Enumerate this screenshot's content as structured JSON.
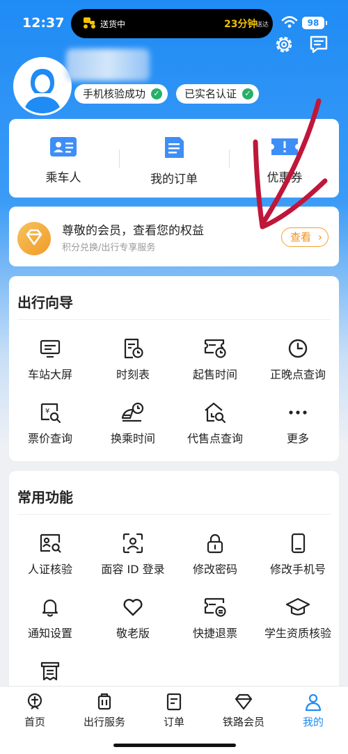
{
  "status_bar": {
    "time": "12:37",
    "island_label": "送货中",
    "island_time": "23分钟",
    "island_suffix": "送达",
    "battery": "98"
  },
  "profile": {
    "badges": [
      "手机核验成功",
      "已实名认证"
    ]
  },
  "quick_actions": [
    {
      "label": "乘车人",
      "icon": "passenger-card-icon"
    },
    {
      "label": "我的订单",
      "icon": "order-doc-icon"
    },
    {
      "label": "优惠券",
      "icon": "coupon-icon"
    }
  ],
  "member": {
    "title": "尊敬的会员，查看您的权益",
    "subtitle": "积分兑换/出行专享服务",
    "button": "查看"
  },
  "travel_guide": {
    "title": "出行向导",
    "items": [
      {
        "label": "车站大屏",
        "icon": "station-screen-icon"
      },
      {
        "label": "时刻表",
        "icon": "timetable-icon"
      },
      {
        "label": "起售时间",
        "icon": "ticket-clock-icon"
      },
      {
        "label": "正晚点查询",
        "icon": "clock-icon"
      },
      {
        "label": "票价查询",
        "icon": "price-search-icon"
      },
      {
        "label": "换乘时间",
        "icon": "transfer-time-icon"
      },
      {
        "label": "代售点查询",
        "icon": "agency-search-icon"
      },
      {
        "label": "更多",
        "icon": "more-dots-icon"
      }
    ]
  },
  "common_functions": {
    "title": "常用功能",
    "items": [
      {
        "label": "人证核验",
        "icon": "id-verify-icon"
      },
      {
        "label": "面容 ID 登录",
        "icon": "face-id-icon"
      },
      {
        "label": "修改密码",
        "icon": "lock-icon"
      },
      {
        "label": "修改手机号",
        "icon": "phone-icon"
      },
      {
        "label": "通知设置",
        "icon": "bell-icon"
      },
      {
        "label": "敬老版",
        "icon": "heart-icon"
      },
      {
        "label": "快捷退票",
        "icon": "refund-ticket-icon"
      },
      {
        "label": "学生资质核验",
        "icon": "graduation-cap-icon"
      },
      {
        "label": "",
        "icon": "receipt-icon"
      }
    ]
  },
  "tabbar": [
    {
      "label": "首页",
      "icon": "home-train-icon"
    },
    {
      "label": "出行服务",
      "icon": "luggage-icon"
    },
    {
      "label": "订单",
      "icon": "order-icon"
    },
    {
      "label": "铁路会员",
      "icon": "member-diamond-icon"
    },
    {
      "label": "我的",
      "icon": "profile-icon",
      "active": true
    }
  ],
  "colors": {
    "primary": "#1f8bf5",
    "member_orange": "#f0901a",
    "check_green": "#27b067",
    "annotation_red": "#c0163a"
  }
}
